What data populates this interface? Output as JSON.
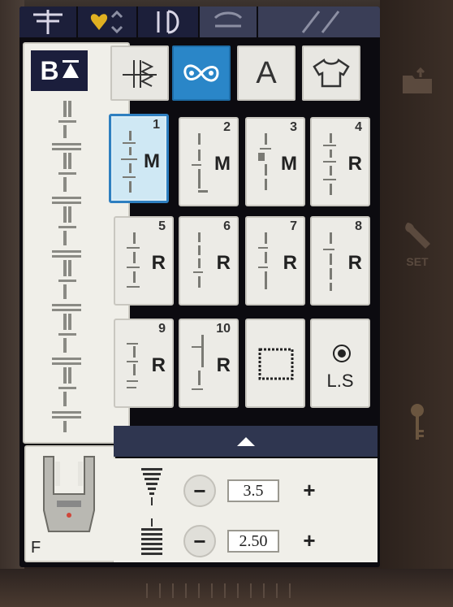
{
  "top_tabs": [
    {
      "icon": "utility-stitch-icon",
      "state": "normal"
    },
    {
      "icon": "heart-stitch-icon",
      "state": "normal"
    },
    {
      "icon": "decorative-stitch-icon",
      "state": "normal"
    },
    {
      "icon": "dim-tab-icon-1",
      "state": "dim"
    },
    {
      "icon": "dim-tab-icon-2",
      "state": "dim"
    }
  ],
  "left_panel": {
    "mode_button": "B"
  },
  "categories": [
    {
      "icon": "utility-stitch-category-icon",
      "label": ""
    },
    {
      "icon": "decorative-stitch-category-icon",
      "label": "",
      "active": true
    },
    {
      "icon": "character-category-icon",
      "label": "A"
    },
    {
      "icon": "garment-category-icon",
      "label": ""
    }
  ],
  "stitches": [
    {
      "number": "1",
      "mode": "M",
      "selected": true
    },
    {
      "number": "2",
      "mode": "M"
    },
    {
      "number": "3",
      "mode": "M"
    },
    {
      "number": "4",
      "mode": "R"
    },
    {
      "number": "5",
      "mode": "R"
    },
    {
      "number": "6",
      "mode": "R"
    },
    {
      "number": "7",
      "mode": "R"
    },
    {
      "number": "8",
      "mode": "R"
    },
    {
      "number": "9",
      "mode": "R"
    },
    {
      "number": "10",
      "mode": "R"
    },
    {
      "number": "",
      "mode": "",
      "icon": "stitch-frame-icon"
    },
    {
      "number": "",
      "mode": "L.S",
      "icon": "stitch-lock-icon"
    }
  ],
  "presser_foot": {
    "label": "F"
  },
  "settings": {
    "width": {
      "value": "3.5",
      "minus": "−",
      "plus": "+"
    },
    "length": {
      "value": "2.50",
      "minus": "−",
      "plus": "+"
    }
  },
  "right_keys": [
    {
      "icon": "folder-export-icon",
      "label": ""
    },
    {
      "icon": "wrench-icon",
      "label": "SET"
    },
    {
      "icon": "key-icon",
      "label": ""
    }
  ]
}
